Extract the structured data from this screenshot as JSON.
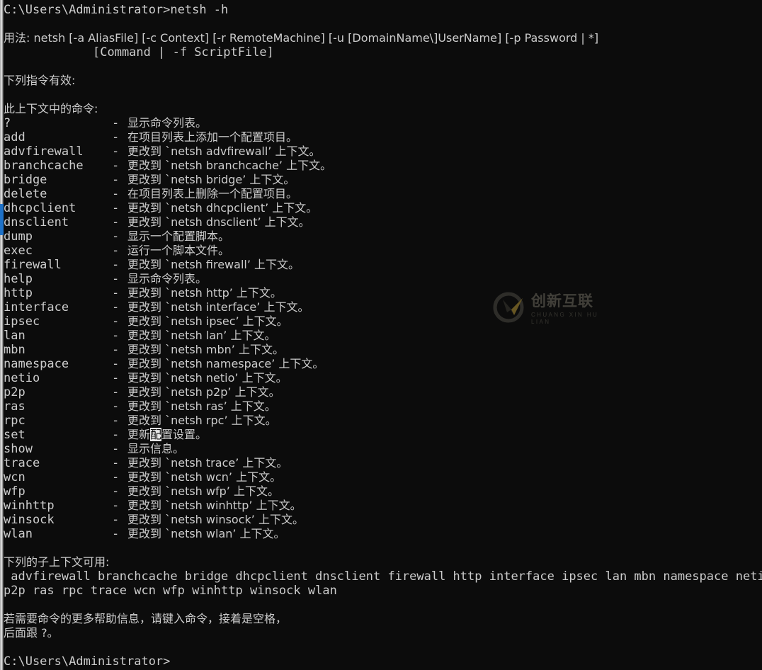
{
  "window": {
    "type": "windows-command-prompt",
    "background_color": "#0c0c0c",
    "text_color": "#cccccc",
    "scrollbar_thumb_color": "#1f72c8"
  },
  "prompt_line": "C:\\Users\\Administrator>netsh -h",
  "usage": {
    "line1": "用法: netsh [-a AliasFile] [-c Context] [-r RemoteMachine] [-u [DomainName\\]UserName] [-p Password | *]",
    "line2": "[Command | -f ScriptFile]"
  },
  "headings": {
    "valid_commands": "下列指令有效:",
    "commands_in_context": "此上下文中的命令:",
    "subcontexts_available": "下列的子上下文可用:"
  },
  "commands": [
    {
      "name": "?",
      "dash": "-",
      "desc": "显示命令列表。"
    },
    {
      "name": "add",
      "dash": "-",
      "desc": "在项目列表上添加一个配置项目。"
    },
    {
      "name": "advfirewall",
      "dash": "-",
      "desc": "更改到 `netsh advfirewall’ 上下文。"
    },
    {
      "name": "branchcache",
      "dash": "-",
      "desc": "更改到 `netsh branchcache’ 上下文。"
    },
    {
      "name": "bridge",
      "dash": "-",
      "desc": "更改到 `netsh bridge’ 上下文。"
    },
    {
      "name": "delete",
      "dash": "-",
      "desc": "在项目列表上删除一个配置项目。"
    },
    {
      "name": "dhcpclient",
      "dash": "-",
      "desc": "更改到 `netsh dhcpclient’ 上下文。"
    },
    {
      "name": "dnsclient",
      "dash": "-",
      "desc": "更改到 `netsh dnsclient’ 上下文。"
    },
    {
      "name": "dump",
      "dash": "-",
      "desc": "显示一个配置脚本。"
    },
    {
      "name": "exec",
      "dash": "-",
      "desc": "运行一个脚本文件。"
    },
    {
      "name": "firewall",
      "dash": "-",
      "desc": "更改到 `netsh firewall’ 上下文。"
    },
    {
      "name": "help",
      "dash": "-",
      "desc": "显示命令列表。"
    },
    {
      "name": "http",
      "dash": "-",
      "desc": "更改到 `netsh http’ 上下文。"
    },
    {
      "name": "interface",
      "dash": "-",
      "desc": "更改到 `netsh interface’ 上下文。"
    },
    {
      "name": "ipsec",
      "dash": "-",
      "desc": "更改到 `netsh ipsec’ 上下文。"
    },
    {
      "name": "lan",
      "dash": "-",
      "desc": "更改到 `netsh lan’ 上下文。"
    },
    {
      "name": "mbn",
      "dash": "-",
      "desc": "更改到 `netsh mbn’ 上下文。"
    },
    {
      "name": "namespace",
      "dash": "-",
      "desc": "更改到 `netsh namespace’ 上下文。"
    },
    {
      "name": "netio",
      "dash": "-",
      "desc": "更改到 `netsh netio’ 上下文。"
    },
    {
      "name": "p2p",
      "dash": "-",
      "desc": "更改到 `netsh p2p’ 上下文。"
    },
    {
      "name": "ras",
      "dash": "-",
      "desc": "更改到 `netsh ras’ 上下文。"
    },
    {
      "name": "rpc",
      "dash": "-",
      "desc": "更改到 `netsh rpc’ 上下文。"
    },
    {
      "name": "set",
      "dash": "-",
      "desc": "更新配置设置。",
      "selection": {
        "before": "更新",
        "selected": "配",
        "after": "置设置。"
      }
    },
    {
      "name": "show",
      "dash": "-",
      "desc": "显示信息。"
    },
    {
      "name": "trace",
      "dash": "-",
      "desc": "更改到 `netsh trace’ 上下文。"
    },
    {
      "name": "wcn",
      "dash": "-",
      "desc": "更改到 `netsh wcn’ 上下文。"
    },
    {
      "name": "wfp",
      "dash": "-",
      "desc": "更改到 `netsh wfp’ 上下文。"
    },
    {
      "name": "winhttp",
      "dash": "-",
      "desc": "更改到 `netsh winhttp’ 上下文。"
    },
    {
      "name": "winsock",
      "dash": "-",
      "desc": "更改到 `netsh winsock’ 上下文。"
    },
    {
      "name": "wlan",
      "dash": "-",
      "desc": "更改到 `netsh wlan’ 上下文。"
    }
  ],
  "subcontexts": {
    "line1": " advfirewall branchcache bridge dhcpclient dnsclient firewall http interface ipsec lan mbn namespace netio",
    "line2": "p2p ras rpc trace wcn wfp winhttp winsock wlan"
  },
  "footer": {
    "line1": "若需要命令的更多帮助信息，请键入命令，接着是空格，",
    "line2": "后面跟 ?。"
  },
  "final_prompt": "C:\\Users\\Administrator>",
  "watermark": {
    "title": "创新互联",
    "subtitle": "CHUANG XIN HU LIAN",
    "logo_glyph": "CX",
    "text_color": "#6d6a5e",
    "accent_color": "#b39334"
  }
}
